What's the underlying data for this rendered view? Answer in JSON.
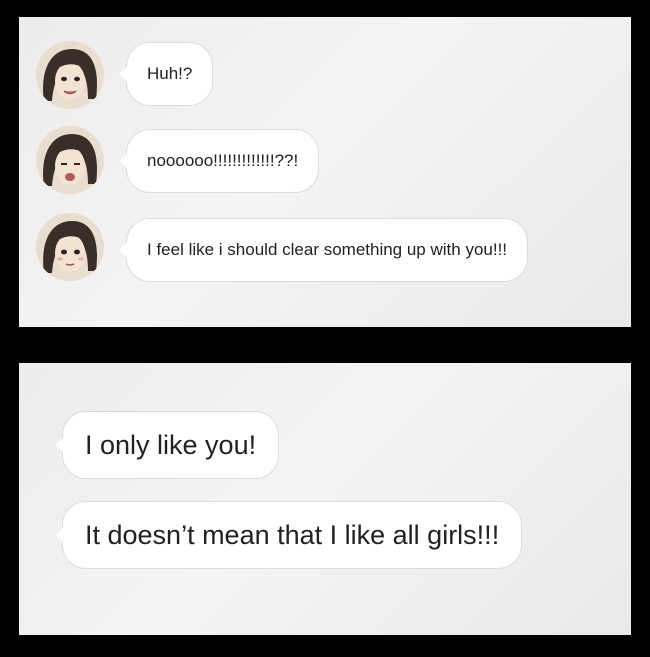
{
  "top_panel": {
    "messages": [
      {
        "text": "Huh!?",
        "avatar": "girl-avatar-icon"
      },
      {
        "text": "noooooo!!!!!!!!!!!!!??!",
        "avatar": "girl-avatar-icon"
      },
      {
        "text": "I feel like i should clear something up with you!!!",
        "avatar": "girl-avatar-icon"
      }
    ]
  },
  "bottom_panel": {
    "messages": [
      {
        "text": "I only like you!"
      },
      {
        "text": "It doesn’t mean that I like all girls!!!"
      }
    ]
  },
  "colors": {
    "frame": "#000000",
    "panel_bg": "#eeeeee",
    "bubble_bg": "#ffffff",
    "bubble_border": "#dcdcdc",
    "text": "#222222",
    "hair": "#3a2e28",
    "skin": "#f3e3d2"
  }
}
